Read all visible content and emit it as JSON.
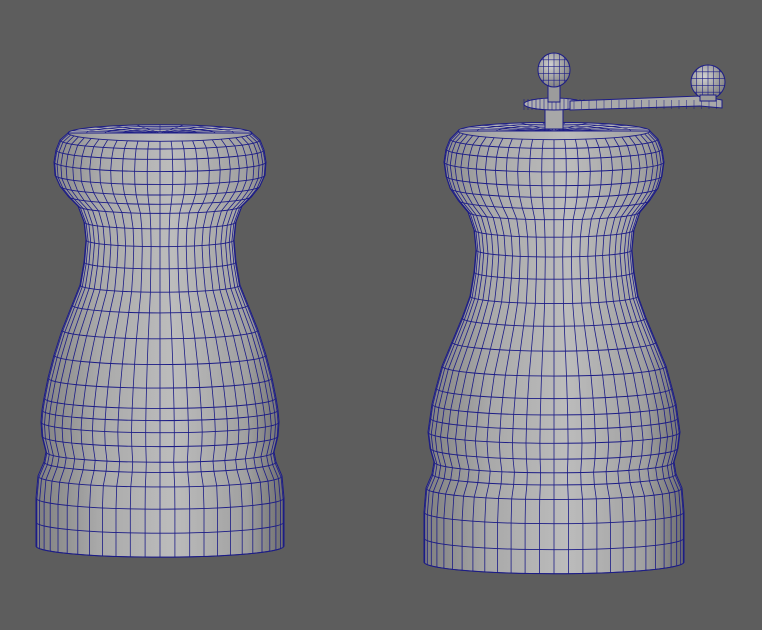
{
  "viewport": {
    "background": "#5d5d5d",
    "display_mode": "wireframe-on-shaded"
  },
  "objects": [
    {
      "name": "salt-shaker",
      "type": "mesh"
    },
    {
      "name": "pepper-mill",
      "type": "mesh",
      "has_crank_handle": true
    }
  ],
  "colors": {
    "shade_light": "#b9b9b9",
    "shade_mid": "#a2a2a2",
    "shade_dark": "#777777",
    "wire": "#1c1c86"
  }
}
